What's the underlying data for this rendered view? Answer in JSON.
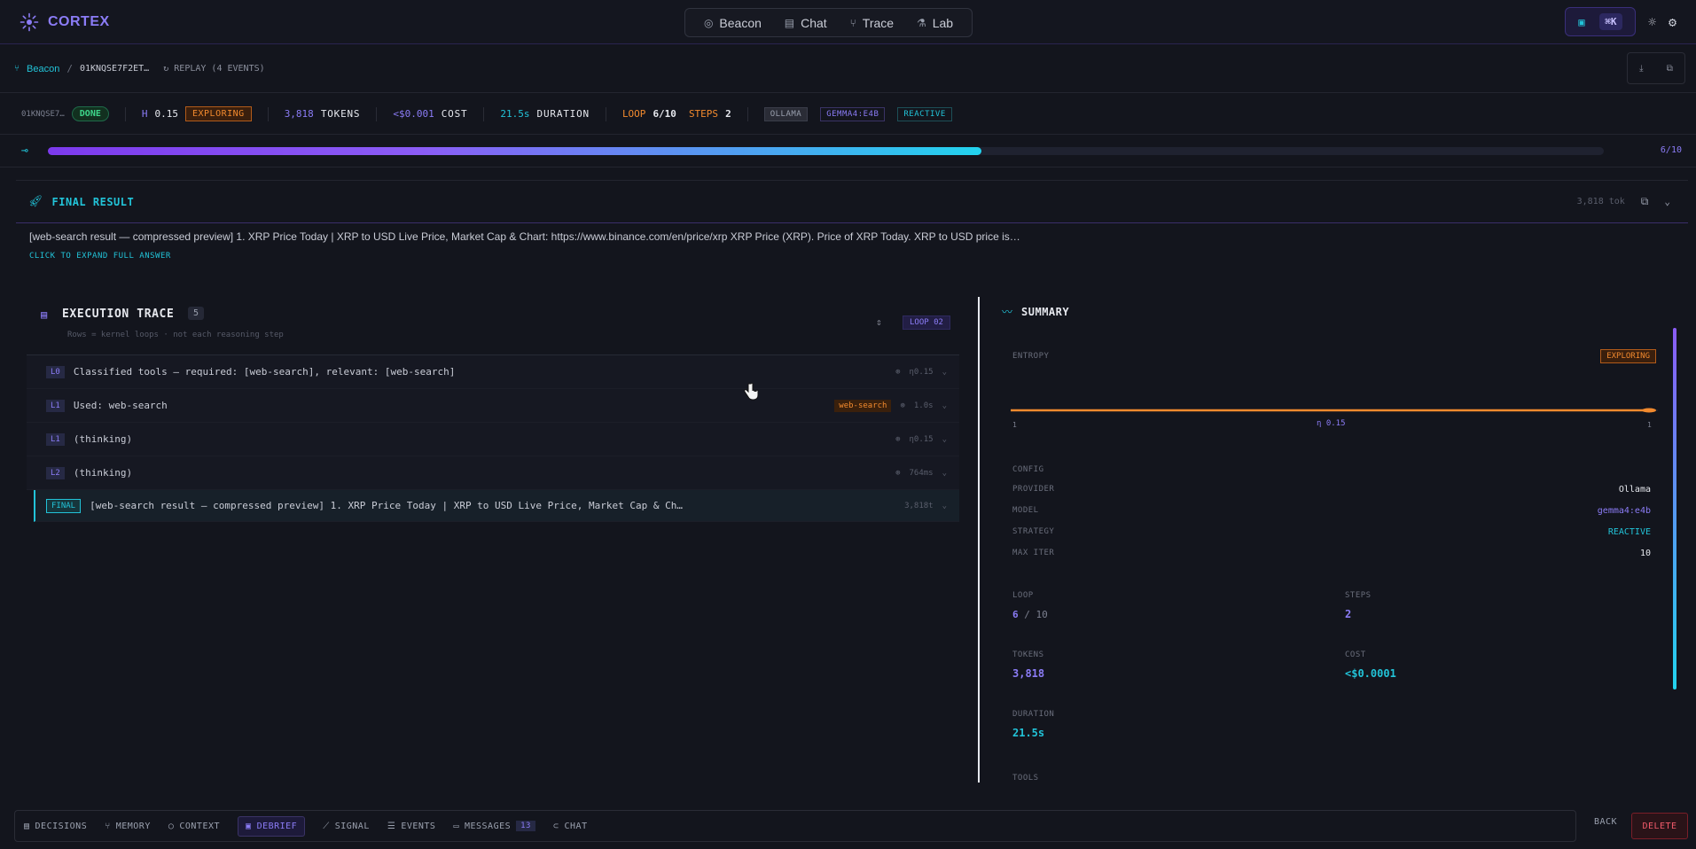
{
  "app": {
    "name": "CORTEX"
  },
  "nav": {
    "items": [
      {
        "label": "Beacon",
        "icon": "radar-icon"
      },
      {
        "label": "Chat",
        "icon": "chat-icon"
      },
      {
        "label": "Trace",
        "icon": "trace-icon"
      },
      {
        "label": "Lab",
        "icon": "flask-icon"
      }
    ]
  },
  "toolbar": {
    "shortcut": "⌘K"
  },
  "breadcrumb": {
    "root": "Beacon",
    "id": "01KNQSE7F2ET…",
    "replay": "REPLAY (4 EVENTS)"
  },
  "stats": {
    "run_id": "01KNQSE7…",
    "status": "DONE",
    "entropy_label": "H",
    "entropy_value": "0.15",
    "entropy_state": "EXPLORING",
    "tokens_value": "3,818",
    "tokens_label": "TOKENS",
    "cost_value": "<$0.001",
    "cost_label": "COST",
    "duration_value": "21.5s",
    "duration_label": "DURATION",
    "loop_label": "LOOP",
    "loop_value": "6/10",
    "steps_label": "STEPS",
    "steps_value": "2",
    "tags": [
      "OLLAMA",
      "GEMMA4:E4B",
      "REACTIVE"
    ]
  },
  "progress": {
    "current": 6,
    "max": 10,
    "text": "6/10"
  },
  "final_result": {
    "title": "FINAL RESULT",
    "tokens": "3,818 tok",
    "text": "[web-search result — compressed preview] 1. XRP Price Today | XRP to USD Live Price, Market Cap & Chart: https://www.binance.com/en/price/xrp XRP Price (XRP). Price of XRP Today. XRP to USD price is…",
    "expand_label": "CLICK TO EXPAND FULL ANSWER"
  },
  "trace": {
    "title": "EXECUTION TRACE",
    "count": "5",
    "subtitle": "Rows = kernel loops · not each reasoning step",
    "loop_badge": "LOOP 02",
    "rows": [
      {
        "level": "L0",
        "text": "Classified tools — required: [web-search], relevant: [web-search]",
        "tag": "",
        "meta": "η0.15"
      },
      {
        "level": "L1",
        "text": "Used: web-search",
        "tag": "web-search",
        "meta": "1.0s"
      },
      {
        "level": "L1",
        "text": "(thinking)",
        "tag": "",
        "meta": "η0.15"
      },
      {
        "level": "L2",
        "text": "(thinking)",
        "tag": "",
        "meta": "764ms"
      },
      {
        "level": "FINAL",
        "text": "[web-search result — compressed preview] 1. XRP Price Today | XRP to USD Live Price, Market Cap & Ch…",
        "tag": "",
        "meta": "3,818t"
      }
    ]
  },
  "summary": {
    "title": "SUMMARY",
    "entropy_label": "ENTROPY",
    "entropy_state": "EXPLORING",
    "entropy_axis": {
      "left": "1",
      "mid": "η 0.15",
      "right": "1"
    },
    "config_label": "CONFIG",
    "config": [
      {
        "label": "PROVIDER",
        "value": "Ollama"
      },
      {
        "label": "MODEL",
        "value": "gemma4:e4b"
      },
      {
        "label": "STRATEGY",
        "value": "REACTIVE"
      },
      {
        "label": "MAX ITER",
        "value": "10"
      }
    ],
    "loop_label": "LOOP",
    "loop_value": "6",
    "loop_sep": "/",
    "loop_max": "10",
    "steps_label": "STEPS",
    "steps_value": "2",
    "tokens_label": "TOKENS",
    "tokens_value": "3,818",
    "cost_label": "COST",
    "cost_value": "<$0.0001",
    "duration_label": "DURATION",
    "duration_value": "21.5s",
    "tools_label": "TOOLS"
  },
  "bottom_tabs": [
    {
      "label": "DECISIONS"
    },
    {
      "label": "MEMORY"
    },
    {
      "label": "CONTEXT"
    },
    {
      "label": "DEBRIEF"
    },
    {
      "label": "SIGNAL"
    },
    {
      "label": "EVENTS"
    },
    {
      "label": "MESSAGES",
      "count": "13"
    },
    {
      "label": "CHAT"
    }
  ],
  "actions": {
    "back": "BACK",
    "delete": "DELETE"
  },
  "colors": {
    "accent": "#8b7cf6",
    "cyan": "#22c3d8",
    "orange": "#f28a2e",
    "success": "#3ed68a",
    "danger": "#f05a6a"
  }
}
